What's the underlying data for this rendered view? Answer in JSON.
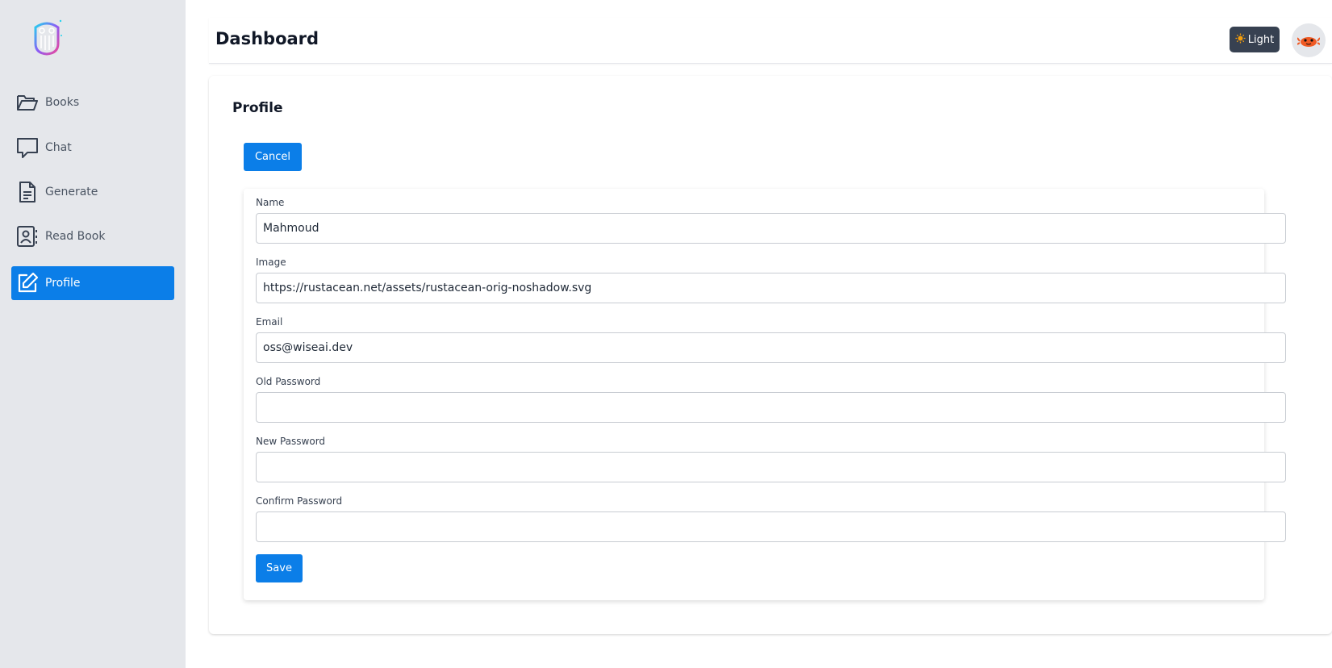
{
  "sidebar": {
    "items": [
      {
        "label": "Books",
        "icon": "folder-open-icon"
      },
      {
        "label": "Chat",
        "icon": "chat-bubble-icon"
      },
      {
        "label": "Generate",
        "icon": "document-icon"
      },
      {
        "label": "Read Book",
        "icon": "contact-book-icon"
      },
      {
        "label": "Profile",
        "icon": "edit-icon",
        "active": true
      }
    ]
  },
  "header": {
    "title": "Dashboard",
    "theme_button_label": "Light",
    "theme_icon": "sun-icon"
  },
  "profile": {
    "title": "Profile",
    "cancel_label": "Cancel",
    "save_label": "Save",
    "fields": {
      "name": {
        "label": "Name",
        "value": "Mahmoud"
      },
      "image": {
        "label": "Image",
        "value": "https://rustacean.net/assets/rustacean-orig-noshadow.svg"
      },
      "email": {
        "label": "Email",
        "value": "oss@wiseai.dev"
      },
      "old_password": {
        "label": "Old Password",
        "value": ""
      },
      "new_password": {
        "label": "New Password",
        "value": ""
      },
      "confirm_password": {
        "label": "Confirm Password",
        "value": ""
      }
    }
  },
  "colors": {
    "accent": "#0b7ee8",
    "sidebar_bg": "#e5e7eb",
    "theme_button_bg": "#374151"
  }
}
